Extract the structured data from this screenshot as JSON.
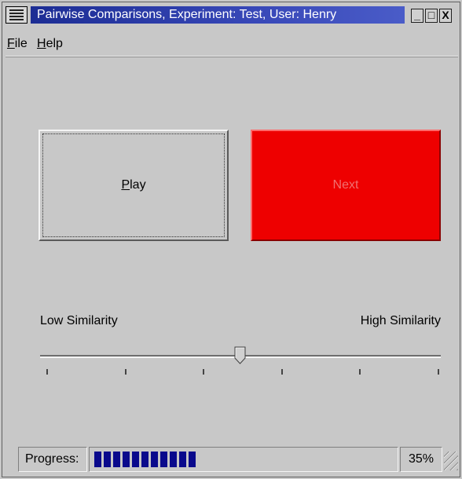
{
  "window": {
    "title": "Pairwise Comparisons, Experiment: Test, User: Henry",
    "controls": {
      "minimize": "_",
      "maximize": "□",
      "close": "X"
    }
  },
  "menu": {
    "items": [
      {
        "mnemonic": "F",
        "rest": "ile"
      },
      {
        "mnemonic": "H",
        "rest": "elp"
      }
    ]
  },
  "buttons": {
    "play": {
      "mnemonic": "P",
      "rest": "lay"
    },
    "next": {
      "label": "Next",
      "color": "#ee0000"
    }
  },
  "slider": {
    "low_label": "Low Similarity",
    "high_label": "High Similarity",
    "value": 0.5,
    "tick_count": 6
  },
  "status": {
    "progress_label": "Progress:",
    "progress_value": 0.35,
    "progress_text": "35%",
    "progress_color": "#0a0a8c"
  }
}
